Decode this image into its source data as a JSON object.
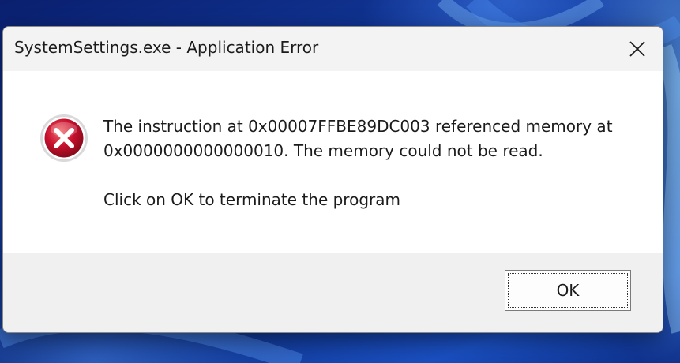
{
  "dialog": {
    "title": "SystemSettings.exe - Application Error",
    "close_icon": "close-icon",
    "error_icon": "error-icon",
    "message_lines": [
      "The instruction at 0x00007FFBE89DC003 referenced memory at",
      "0x0000000000000010. The memory could not be read."
    ],
    "instruction": "Click on OK to terminate the program",
    "ok_label": "OK"
  },
  "colors": {
    "titlebar": "#f3f3f3",
    "content": "#ffffff",
    "footer": "#f0f0f0",
    "error_red": "#c8102e",
    "desktop_blue": "#123a9e"
  }
}
